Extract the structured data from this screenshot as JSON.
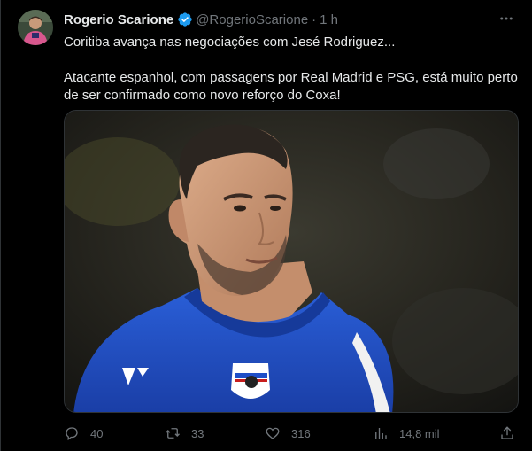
{
  "author": {
    "name": "Rogerio Scarione",
    "handle": "@RogerioScarione",
    "separator": "·",
    "time": "1 h",
    "verified": true
  },
  "tweet": {
    "line1": "Coritiba avança nas negociações com Jesé Rodriguez...",
    "line2": "Atacante espanhol, com passagens por Real Madrid e PSG, está muito perto de ser confirmado como novo reforço do Coxa!"
  },
  "media": {
    "description_icon": "photo-of-player"
  },
  "actions": {
    "replies": "40",
    "retweets": "33",
    "likes": "316",
    "views": "14,8 mil"
  },
  "colors": {
    "background": "#000000",
    "text": "#e7e9ea",
    "muted": "#71767b",
    "verified": "#1d9bf0",
    "border": "#2f3336",
    "jersey": "#1f4fc8"
  }
}
